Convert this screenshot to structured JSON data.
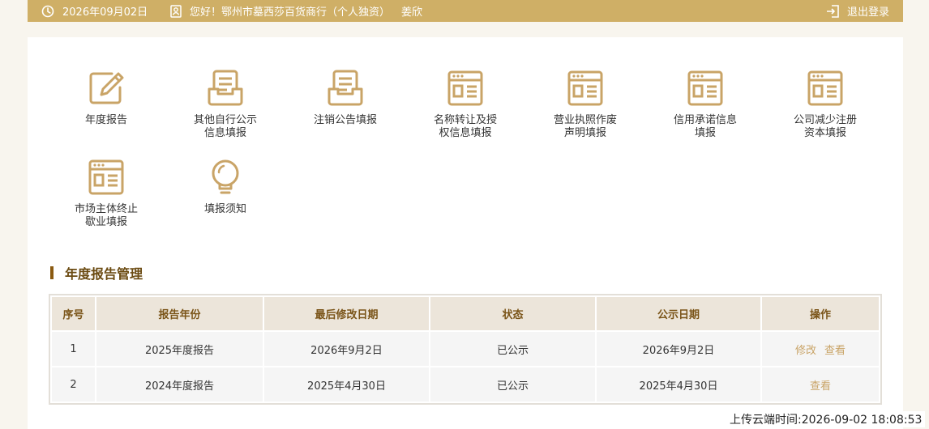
{
  "header": {
    "date": "2026年09月02日",
    "greeting": "您好！鄂州市墓西莎百货商行（个人独资）",
    "user": "姜欣",
    "logout": "退出登录"
  },
  "menu": [
    {
      "label": "年度报告",
      "icon": "edit-icon"
    },
    {
      "label": "其他自行公示\n信息填报",
      "icon": "inbox-document-icon"
    },
    {
      "label": "注销公告填报",
      "icon": "inbox-document-icon"
    },
    {
      "label": "名称转让及授\n权信息填报",
      "icon": "browser-form-icon"
    },
    {
      "label": "营业执照作废\n声明填报",
      "icon": "browser-form-icon"
    },
    {
      "label": "信用承诺信息\n填报",
      "icon": "browser-form-icon"
    },
    {
      "label": "公司减少注册\n资本填报",
      "icon": "browser-form-icon"
    },
    {
      "label": "市场主体终止\n歇业填报",
      "icon": "browser-form-icon"
    },
    {
      "label": "填报须知",
      "icon": "lightbulb-icon"
    }
  ],
  "section_title": "年度报告管理",
  "table": {
    "headers": [
      "序号",
      "报告年份",
      "最后修改日期",
      "状态",
      "公示日期",
      "操作"
    ],
    "rows": [
      {
        "no": "1",
        "year": "2025年度报告",
        "modified": "2026年9月2日",
        "status": "已公示",
        "published": "2026年9月2日",
        "ops": [
          "修改",
          "查看"
        ]
      },
      {
        "no": "2",
        "year": "2024年度报告",
        "modified": "2025年4月30日",
        "status": "已公示",
        "published": "2025年4月30日",
        "ops": [
          "查看"
        ]
      }
    ]
  },
  "upload_time": "上传云端时间:2026-09-02 18:08:53",
  "colors": {
    "accent": "#cfaf66",
    "title": "#6b4b12",
    "link": "#c9a467"
  }
}
